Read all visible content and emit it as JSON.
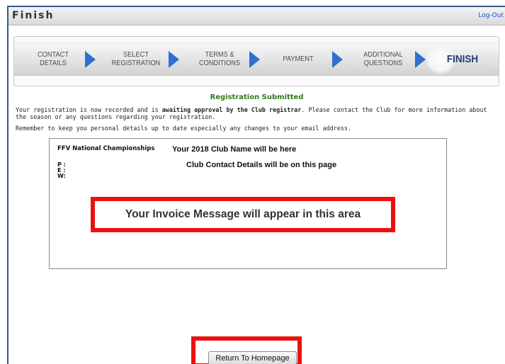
{
  "window": {
    "title": "Finish",
    "logout_label": "Log-Out"
  },
  "steps": [
    {
      "line1": "Contact",
      "line2": "Details"
    },
    {
      "line1": "Select",
      "line2": "Registration"
    },
    {
      "line1": "Terms &",
      "line2": "Conditions"
    },
    {
      "line1": "Payment",
      "line2": ""
    },
    {
      "line1": "Additional",
      "line2": "Questions"
    },
    {
      "line1": "Finish",
      "line2": ""
    }
  ],
  "colors": {
    "accent": "#2f6fd0",
    "success_heading": "#2e7d16",
    "highlight": "#ea1111"
  },
  "main": {
    "heading": "Registration Submitted",
    "para1_before": "Your registration is now recorded and is ",
    "para1_bold": "awaiting approval by the Club registrar",
    "para1_after": ". Please contact the Club for more information about the season or any questions regarding your registration.",
    "para2": "Remember to keep you personal details up to date especially any changes to your email address."
  },
  "invoice": {
    "club_label": "FFV National Championships",
    "club_name": "Your 2018 Club Name will be here",
    "phone_label": "P :",
    "email_label": "E :",
    "web_label": "W:",
    "contact_note": "Club Contact Details will be on this page",
    "message": "Your Invoice Message will appear in this area"
  },
  "actions": {
    "return_label": "Return To Homepage"
  }
}
